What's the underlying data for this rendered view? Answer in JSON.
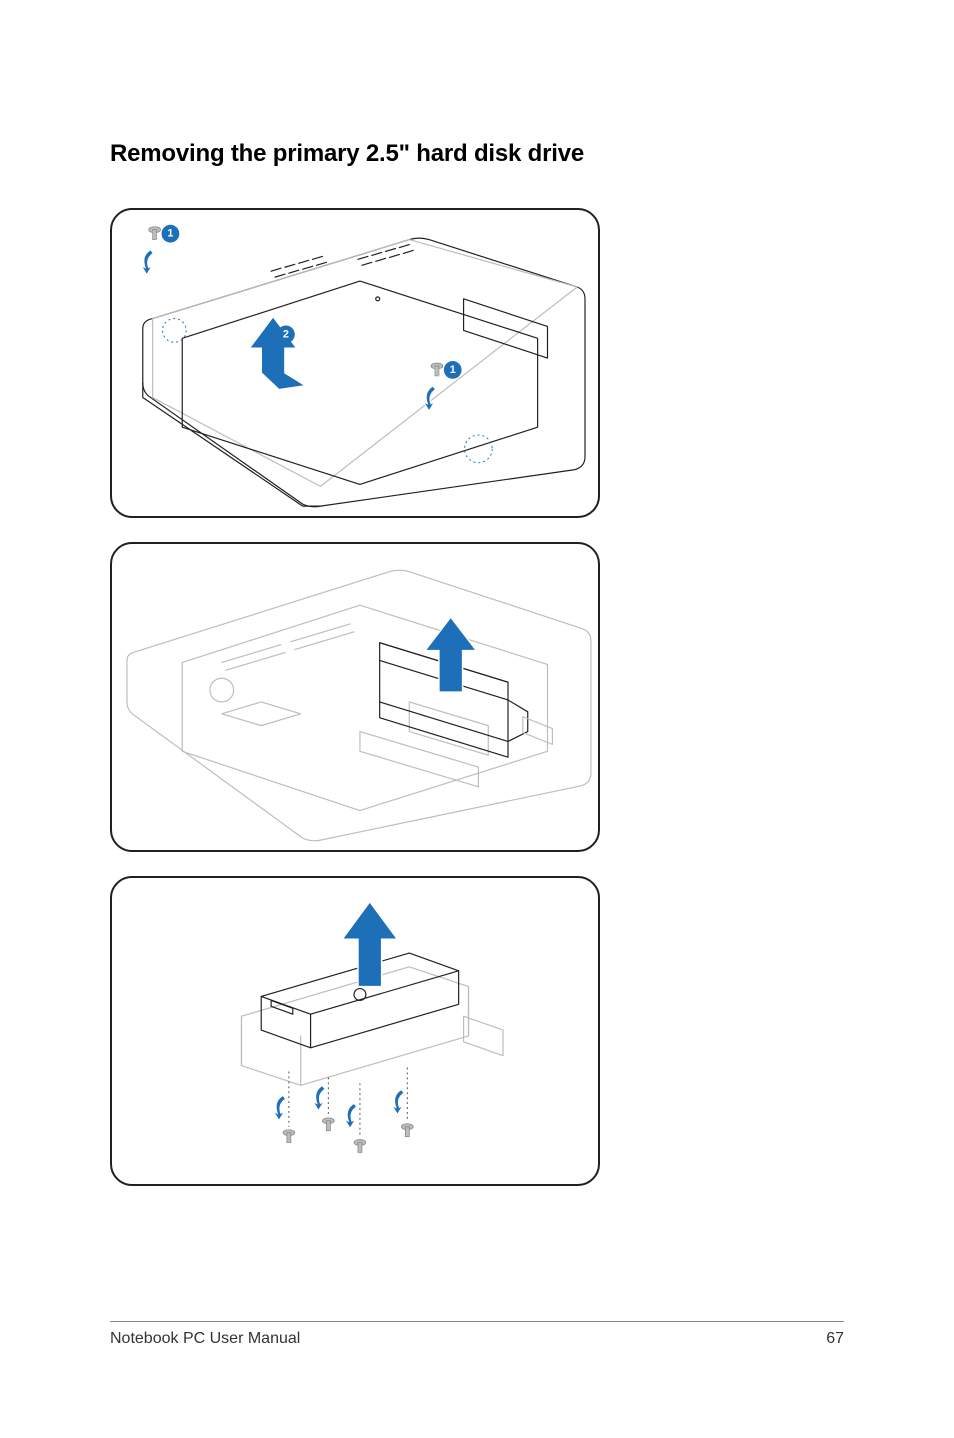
{
  "heading": "Removing the primary 2.5\" hard disk drive",
  "callouts": {
    "panel1": {
      "top_left": "1",
      "mid_arrow": "2",
      "right_side": "1"
    }
  },
  "footer": {
    "left": "Notebook PC User Manual",
    "right": "67"
  }
}
